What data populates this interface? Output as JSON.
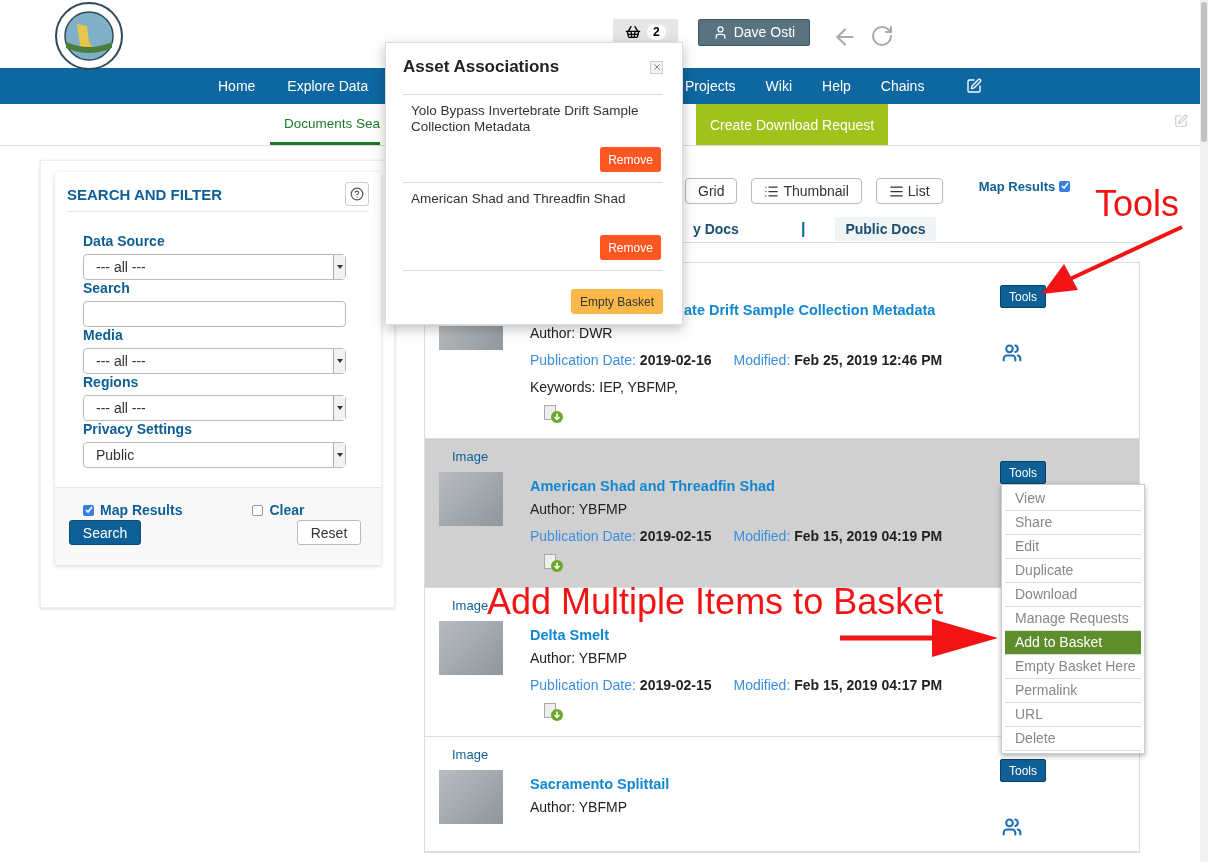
{
  "header": {
    "basket_count": "2",
    "user": "Dave Osti"
  },
  "nav": {
    "left": [
      {
        "label": "Home"
      },
      {
        "label": "Explore Data"
      }
    ],
    "right": [
      {
        "label": "Projects"
      },
      {
        "label": "Wiki"
      },
      {
        "label": "Help"
      },
      {
        "label": "Chains"
      }
    ]
  },
  "subtabs": [
    {
      "label": "Documents Sea",
      "kind": "tab",
      "selected": true
    },
    {
      "label": "Create Download Request",
      "kind": "action",
      "selected": false
    }
  ],
  "search_panel": {
    "title": "SEARCH AND FILTER",
    "fields": [
      {
        "kind": "select",
        "label": "Data Source",
        "value": "--- all ---"
      },
      {
        "kind": "text",
        "label": "Search"
      },
      {
        "kind": "select",
        "label": "Media",
        "value": "--- all ---"
      },
      {
        "kind": "select",
        "label": "Regions",
        "value": "--- all ---"
      },
      {
        "kind": "select",
        "label": "Privacy Settings",
        "value": "Public"
      }
    ],
    "options": [
      {
        "label": "Map Results",
        "checked": true
      },
      {
        "label": "Clear",
        "checked": false
      }
    ],
    "buttons": [
      {
        "label": "Search",
        "kind": "primary"
      },
      {
        "label": "Reset",
        "kind": "secondary"
      }
    ]
  },
  "view_options": [
    {
      "label": "Grid",
      "kind": "grid"
    },
    {
      "label": "Thumbnail",
      "kind": "thumbnail"
    },
    {
      "label": "List",
      "kind": "list"
    }
  ],
  "map_results": {
    "label": "Map Results",
    "checked": true
  },
  "doc_filters": [
    {
      "label": "y Docs",
      "selected": false
    },
    {
      "label": "Public Docs",
      "selected": true
    }
  ],
  "doc_filter_separator": "|",
  "results": [
    {
      "covered": true,
      "title": "ate Drift Sample Collection Metadata",
      "author": "Author: DWR",
      "publication_label": "Publication Date:",
      "publication_date": "2019-02-16",
      "modified_label": "Modified:",
      "modified": "Feb 25, 2019 12:46 PM",
      "keywords": "Keywords: IEP, YBFMP,",
      "download_icon": true,
      "tools_label": "Tools",
      "group_icon": true,
      "highlighted": false,
      "menu_open": false
    },
    {
      "covered": false,
      "type_label": "Image",
      "title": "American Shad and Threadfin Shad",
      "author": "Author: YBFMP",
      "publication_label": "Publication Date:",
      "publication_date": "2019-02-15",
      "modified_label": "Modified:",
      "modified": "Feb 15, 2019 04:19 PM",
      "download_icon": true,
      "tools_label": "Tools",
      "group_icon": false,
      "highlighted": true,
      "menu_open": true
    },
    {
      "covered": false,
      "type_label": "Image",
      "title": "Delta Smelt",
      "author": "Author: YBFMP",
      "publication_label": "Publication Date:",
      "publication_date": "2019-02-15",
      "modified_label": "Modified:",
      "modified": "Feb 15, 2019 04:17 PM",
      "download_icon": true,
      "group_icon": false,
      "highlighted": false,
      "menu_open": false
    },
    {
      "covered": false,
      "type_label": "Image",
      "title": "Sacramento Splittail",
      "author": "Author: YBFMP",
      "download_icon": false,
      "tools_label": "Tools",
      "group_icon": true,
      "highlighted": false,
      "menu_open": false
    }
  ],
  "tools_menu": {
    "items": [
      {
        "label": "View",
        "selected": false
      },
      {
        "label": "Share",
        "selected": false
      },
      {
        "label": "Edit",
        "selected": false
      },
      {
        "label": "Duplicate",
        "selected": false
      },
      {
        "label": "Download",
        "selected": false
      },
      {
        "label": "Manage Requests",
        "selected": false
      },
      {
        "label": "Add to Basket",
        "selected": true
      },
      {
        "label": "Empty Basket Here",
        "selected": false
      },
      {
        "label": "Permalink",
        "selected": false
      },
      {
        "label": "URL",
        "selected": false
      },
      {
        "label": "Delete",
        "selected": false
      }
    ]
  },
  "asset_popup": {
    "title": "Asset Associations",
    "items": [
      {
        "name": "Yolo Bypass Invertebrate Drift Sample Collection Metadata",
        "button": "Remove"
      },
      {
        "name": "American Shad and Threadfin Shad",
        "button": "Remove"
      }
    ],
    "footer_button": "Empty Basket"
  },
  "annotations": [
    {
      "text": "Tools"
    },
    {
      "text": "Add Multiple Items to Basket"
    }
  ]
}
